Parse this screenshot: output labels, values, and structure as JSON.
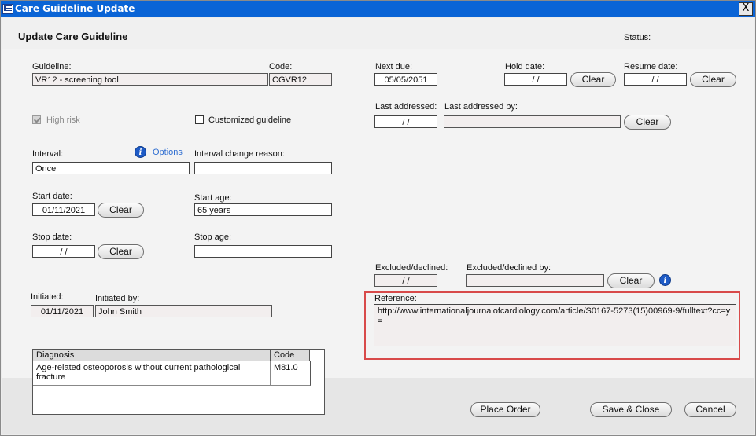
{
  "window": {
    "title": "Care Guideline Update",
    "close_glyph": "X"
  },
  "header": {
    "heading": "Update Care Guideline",
    "status_label": "Status:",
    "status_value": ""
  },
  "guideline": {
    "label": "Guideline:",
    "value": "VR12 - screening tool"
  },
  "code": {
    "label": "Code:",
    "value": "CGVR12"
  },
  "next_due": {
    "label": "Next due:",
    "value": "05/05/2051"
  },
  "hold_date": {
    "label": "Hold date:",
    "value": "/ /",
    "clear": "Clear"
  },
  "resume_date": {
    "label": "Resume date:",
    "value": "/ /",
    "clear": "Clear"
  },
  "high_risk": {
    "label": "High risk",
    "checked": true,
    "disabled": true
  },
  "customized": {
    "label": "Customized guideline",
    "checked": false
  },
  "last_addressed": {
    "label": "Last addressed:",
    "value": "/ /"
  },
  "last_addressed_by": {
    "label": "Last addressed by:",
    "value": "",
    "clear": "Clear"
  },
  "interval": {
    "label": "Interval:",
    "value": "Once",
    "options_link": "Options"
  },
  "interval_change_reason": {
    "label": "Interval change reason:",
    "value": ""
  },
  "start_date": {
    "label": "Start date:",
    "value": "01/11/2021",
    "clear": "Clear"
  },
  "start_age": {
    "label": "Start age:",
    "value": "65 years"
  },
  "stop_date": {
    "label": "Stop date:",
    "value": "/ /",
    "clear": "Clear"
  },
  "stop_age": {
    "label": "Stop age:",
    "value": ""
  },
  "excluded": {
    "label": "Excluded/declined:",
    "value": "/ /"
  },
  "excluded_by": {
    "label": "Excluded/declined by:",
    "value": "",
    "clear": "Clear"
  },
  "initiated": {
    "label": "Initiated:",
    "value": "01/11/2021"
  },
  "initiated_by": {
    "label": "Initiated by:",
    "value": "John Smith"
  },
  "reference": {
    "label": "Reference:",
    "value": "http://www.internationaljournalofcardiology.com/article/S0167-5273(15)00969-9/fulltext?cc=y="
  },
  "diagnosis_table": {
    "columns": [
      "Diagnosis",
      "Code"
    ],
    "rows": [
      {
        "diagnosis": "Age-related osteoporosis without current pathological fracture",
        "code": "M81.0"
      }
    ]
  },
  "footer": {
    "place_order": "Place Order",
    "save_close": "Save & Close",
    "cancel": "Cancel"
  },
  "colors": {
    "title_bar": "#0a64d6",
    "highlight": "#d84a4a",
    "info_icon": "#1e5bc6",
    "link": "#2f6ed1"
  },
  "icons": {
    "window": "window-list-icon",
    "info": "info-icon",
    "close": "close-icon"
  }
}
